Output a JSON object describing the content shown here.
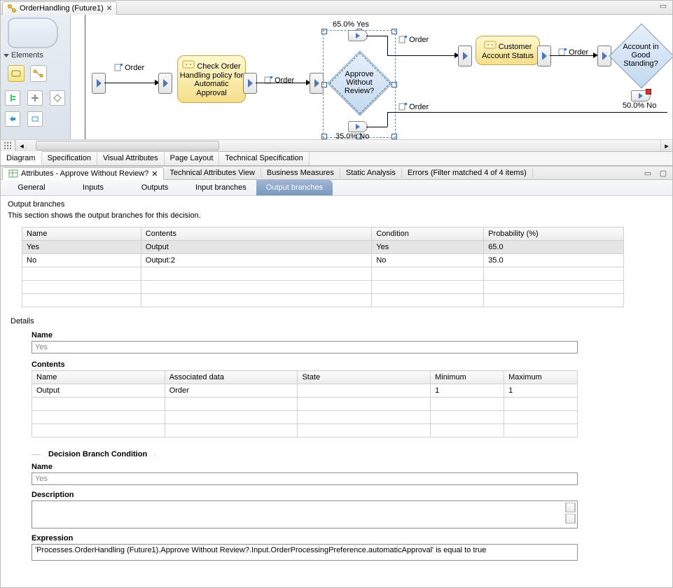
{
  "editor": {
    "title": "OrderHandling (Future1)"
  },
  "editor_bottom_tabs": [
    "Diagram",
    "Specification",
    "Visual Attributes",
    "Page Layout",
    "Technical Specification"
  ],
  "editor_bottom_active": "Diagram",
  "palette": {
    "header": "Elements"
  },
  "diagram": {
    "order_labels": [
      "Order",
      "Order",
      "Order",
      "Order",
      "Order"
    ],
    "task1": "Check Order Handling policy for Automatic Approval",
    "decision1": "Approve Without Review?",
    "decision1_yes": "65.0% Yes",
    "decision1_no": "35.0% No",
    "task2": "Customer Account Status",
    "decision2": "Account in Good Standing?",
    "decision2_no": "50.0% No"
  },
  "views": {
    "tabs": [
      "Attributes - Approve Without Review?",
      "Technical Attributes View",
      "Business Measures",
      "Static Analysis",
      "Errors (Filter matched 4 of 4 items)"
    ],
    "active": 0
  },
  "attr_subtabs": [
    "General",
    "Inputs",
    "Outputs",
    "Input branches",
    "Output branches"
  ],
  "attr_subtab_active": 4,
  "output_branches": {
    "section_label": "Output branches",
    "help": "This section shows the output branches for this decision.",
    "columns": [
      "Name",
      "Contents",
      "Condition",
      "Probability (%)"
    ],
    "rows": [
      {
        "name": "Yes",
        "contents": "Output",
        "condition": "Yes",
        "prob": "65.0"
      },
      {
        "name": "No",
        "contents": "Output:2",
        "condition": "No",
        "prob": "35.0"
      }
    ]
  },
  "details": {
    "header": "Details",
    "name_label": "Name",
    "name_value": "Yes",
    "contents_label": "Contents",
    "contents_columns": [
      "Name",
      "Associated data",
      "State",
      "Minimum",
      "Maximum"
    ],
    "contents_rows": [
      {
        "name": "Output",
        "assoc": "Order",
        "state": "",
        "min": "1",
        "max": "1"
      }
    ]
  },
  "dbc": {
    "section": "Decision Branch Condition",
    "name_label": "Name",
    "name_value": "Yes",
    "desc_label": "Description",
    "desc_value": "",
    "expr_label": "Expression",
    "expr_value": "'Processes.OrderHandling (Future1).Approve Without Review?.Input.OrderProcessingPreference.automaticApproval' is equal to true"
  }
}
